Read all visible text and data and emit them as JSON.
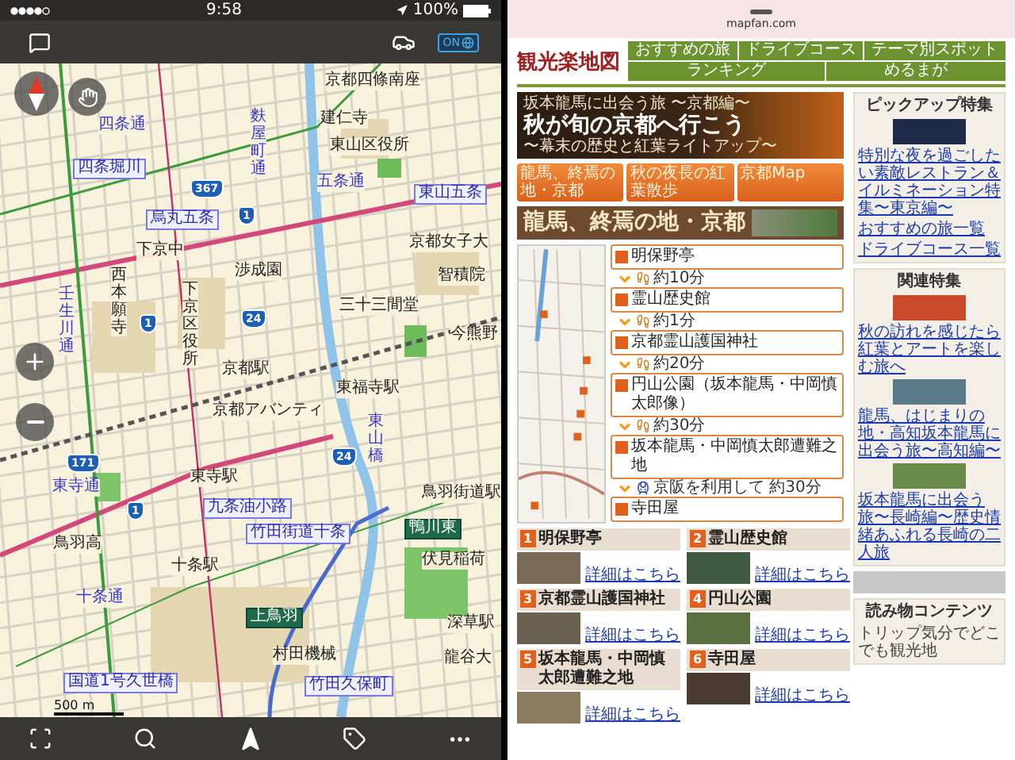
{
  "status_bar": {
    "time": "9:58",
    "battery": "100%"
  },
  "map_toolbar": {
    "toggle_label": "ON"
  },
  "map": {
    "labels": [
      {
        "text": "京都四條南座",
        "kind": "place"
      },
      {
        "text": "四条通",
        "kind": "road"
      },
      {
        "text": "麩屋町通",
        "kind": "road"
      },
      {
        "text": "建仁寺",
        "kind": "place"
      },
      {
        "text": "東山区役所",
        "kind": "place"
      },
      {
        "text": "四条堀川",
        "kind": "junction"
      },
      {
        "text": "五条通",
        "kind": "road"
      },
      {
        "text": "東山五条",
        "kind": "junction"
      },
      {
        "text": "烏丸五条",
        "kind": "junction"
      },
      {
        "text": "下京中",
        "kind": "place"
      },
      {
        "text": "京都女子大",
        "kind": "place"
      },
      {
        "text": "西本願寺",
        "kind": "place"
      },
      {
        "text": "下京区役所",
        "kind": "place"
      },
      {
        "text": "渉成園",
        "kind": "place"
      },
      {
        "text": "智積院",
        "kind": "place"
      },
      {
        "text": "壬生川通",
        "kind": "road"
      },
      {
        "text": "三十三間堂",
        "kind": "place"
      },
      {
        "text": "今熊野",
        "kind": "place"
      },
      {
        "text": "京都駅",
        "kind": "place"
      },
      {
        "text": "東福寺駅",
        "kind": "place"
      },
      {
        "text": "京都アバンティ",
        "kind": "place"
      },
      {
        "text": "東山橋",
        "kind": "road"
      },
      {
        "text": "東寺通",
        "kind": "road"
      },
      {
        "text": "東寺駅",
        "kind": "place"
      },
      {
        "text": "鳥羽街道駅",
        "kind": "place"
      },
      {
        "text": "九条油小路",
        "kind": "junction"
      },
      {
        "text": "竹田街道十条",
        "kind": "junction"
      },
      {
        "text": "鴨川東",
        "kind": "exit"
      },
      {
        "text": "鳥羽高",
        "kind": "place"
      },
      {
        "text": "十条駅",
        "kind": "place"
      },
      {
        "text": "伏見稲荷",
        "kind": "place"
      },
      {
        "text": "十条通",
        "kind": "road"
      },
      {
        "text": "上鳥羽",
        "kind": "exit"
      },
      {
        "text": "深草駅",
        "kind": "place"
      },
      {
        "text": "村田機械",
        "kind": "place"
      },
      {
        "text": "龍谷大",
        "kind": "place"
      },
      {
        "text": "国道1号久世橋",
        "kind": "junction"
      },
      {
        "text": "竹田久保町",
        "kind": "junction"
      }
    ],
    "shields": [
      "367",
      "1",
      "24",
      "1",
      "171",
      "1",
      "24"
    ],
    "scale": "500 m"
  },
  "browser": {
    "url": "mapfan.com"
  },
  "site": {
    "logo": "観光楽地図",
    "nav": [
      "おすすめの旅",
      "ドライブコース",
      "テーマ別スポット",
      "ランキング",
      "めるまが"
    ],
    "banner": {
      "kicker": "坂本龍馬に出会う旅 〜京都編〜",
      "title": "秋が旬の京都へ行こう",
      "subtitle": "〜幕末の歴史と紅葉ライトアップ〜"
    },
    "tabs": [
      "龍馬、終焉の地・京都",
      "秋の夜長の紅葉散歩",
      "京都Map"
    ],
    "hero_title": "龍馬、終焉の地・京都",
    "route": [
      {
        "kind": "stop",
        "text": "明保野亭"
      },
      {
        "kind": "walk",
        "text": "約10分"
      },
      {
        "kind": "stop",
        "text": "霊山歴史館"
      },
      {
        "kind": "walk",
        "text": "約1分"
      },
      {
        "kind": "stop",
        "text": "京都霊山護国神社"
      },
      {
        "kind": "walk",
        "text": "約20分"
      },
      {
        "kind": "stop",
        "text": "円山公園（坂本龍馬・中岡慎太郎像）"
      },
      {
        "kind": "walk",
        "text": "約30分"
      },
      {
        "kind": "stop",
        "text": "坂本龍馬・中岡慎太郎遭難之地"
      },
      {
        "kind": "train",
        "text": "京阪を利用して 約30分"
      },
      {
        "kind": "stop",
        "text": "寺田屋"
      }
    ],
    "spots": [
      {
        "number": "1",
        "title": "明保野亭",
        "link": "詳細はこちら"
      },
      {
        "number": "2",
        "title": "霊山歴史館",
        "link": "詳細はこちら"
      },
      {
        "number": "3",
        "title": "京都霊山護国神社",
        "link": "詳細はこちら"
      },
      {
        "number": "4",
        "title": "円山公園",
        "link": "詳細はこちら"
      },
      {
        "number": "5",
        "title": "坂本龍馬・中岡慎太郎遭難之地",
        "link": "詳細はこちら"
      },
      {
        "number": "6",
        "title": "寺田屋",
        "link": "詳細はこちら"
      }
    ]
  },
  "sidebar": {
    "pickup": {
      "heading": "ピックアップ特集",
      "feature": "特別な夜を過ごしたい素敵レストラン＆イルミネーション特集〜東京編〜",
      "links": [
        "おすすめの旅一覧",
        "ドライブコース一覧"
      ]
    },
    "related": {
      "heading": "関連特集",
      "items": [
        "秋の訪れを感じたら紅葉とアートを楽しむ旅へ",
        "龍馬、はじまりの地・高知坂本龍馬に出会う旅〜高知編〜",
        "坂本龍馬に出会う旅〜長崎編〜歴史情緒あふれる長崎の二人旅"
      ]
    },
    "reading": {
      "heading": "読み物コンテンツ",
      "text": "トリップ気分でどこでも観光地"
    }
  }
}
